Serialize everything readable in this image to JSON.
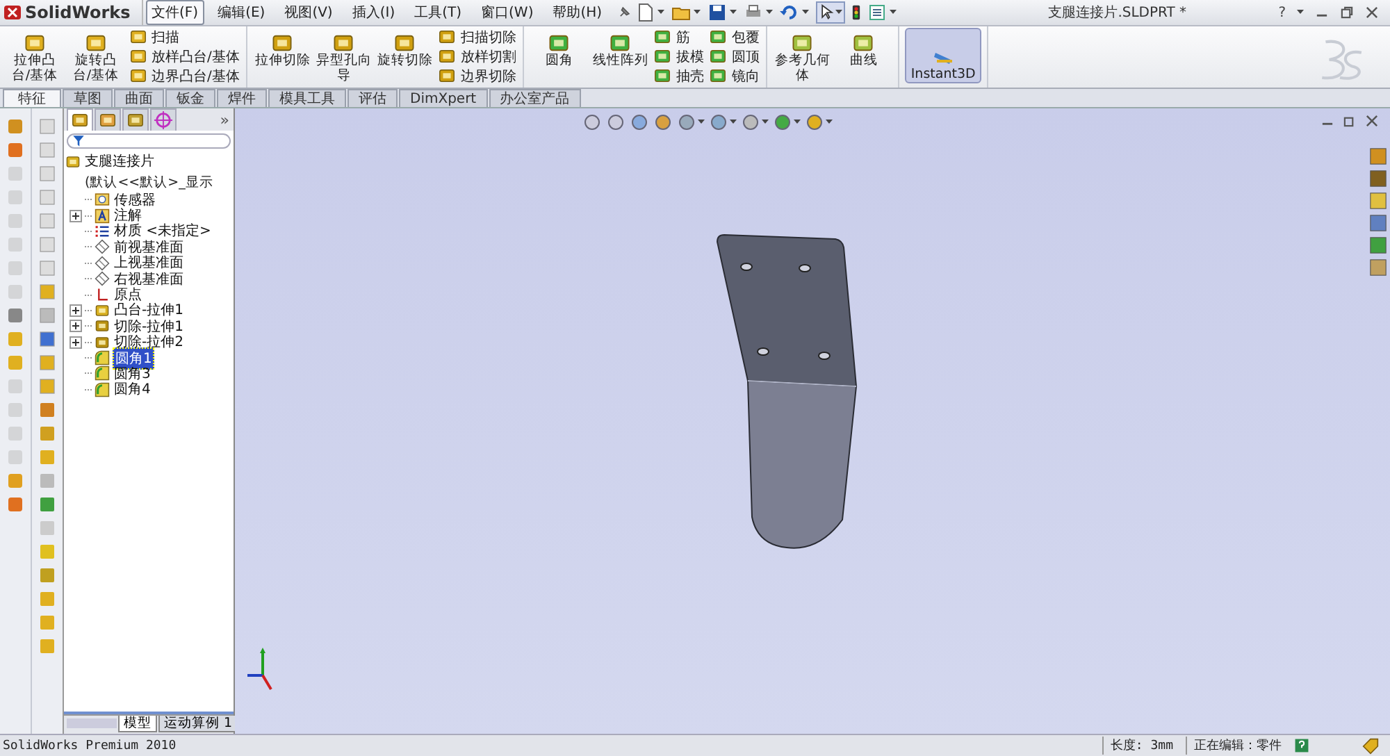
{
  "app": {
    "logo": "SolidWorks"
  },
  "menu": [
    {
      "label": "文件(F)",
      "selected": true
    },
    {
      "label": "编辑(E)",
      "selected": false
    },
    {
      "label": "视图(V)",
      "selected": false
    },
    {
      "label": "插入(I)",
      "selected": false
    },
    {
      "label": "工具(T)",
      "selected": false
    },
    {
      "label": "窗口(W)",
      "selected": false
    },
    {
      "label": "帮助(H)",
      "selected": false
    }
  ],
  "window": {
    "title": "支腿连接片.SLDPRT *",
    "help": "?"
  },
  "ribbon": {
    "groups": [
      {
        "items": [
          {
            "kind": "large",
            "label": "拉伸凸台/基体"
          },
          {
            "kind": "large",
            "label": "旋转凸台/基体"
          },
          {
            "kind": "small",
            "label": "扫描"
          },
          {
            "kind": "small",
            "label": "放样凸台/基体"
          },
          {
            "kind": "small",
            "label": "边界凸台/基体"
          }
        ]
      },
      {
        "items": [
          {
            "kind": "large",
            "label": "拉伸切除"
          },
          {
            "kind": "large",
            "label": "异型孔向导"
          },
          {
            "kind": "large",
            "label": "旋转切除"
          },
          {
            "kind": "small",
            "label": "扫描切除"
          },
          {
            "kind": "small",
            "label": "放样切割"
          },
          {
            "kind": "small",
            "label": "边界切除"
          }
        ]
      },
      {
        "items": [
          {
            "kind": "large",
            "label": "圆角"
          },
          {
            "kind": "large",
            "label": "线性阵列"
          },
          {
            "kind": "small",
            "label": "筋"
          },
          {
            "kind": "small",
            "label": "拔模"
          },
          {
            "kind": "small",
            "label": "抽壳"
          },
          {
            "kind": "small",
            "label": "包覆"
          },
          {
            "kind": "small",
            "label": "圆顶"
          },
          {
            "kind": "small",
            "label": "镜向"
          }
        ]
      },
      {
        "items": [
          {
            "kind": "large",
            "label": "参考几何体"
          },
          {
            "kind": "large",
            "label": "曲线"
          }
        ]
      },
      {
        "items": [
          {
            "kind": "toggle",
            "label": "Instant3D",
            "selected": true
          }
        ]
      }
    ]
  },
  "feature_tabs": [
    {
      "label": "特征",
      "selected": true
    },
    {
      "label": "草图",
      "selected": false
    },
    {
      "label": "曲面",
      "selected": false
    },
    {
      "label": "钣金",
      "selected": false
    },
    {
      "label": "焊件",
      "selected": false
    },
    {
      "label": "模具工具",
      "selected": false
    },
    {
      "label": "评估",
      "selected": false
    },
    {
      "label": "DimXpert",
      "selected": false
    },
    {
      "label": "办公室产品",
      "selected": false
    }
  ],
  "panel": {
    "collapse": "»",
    "tree": {
      "label": "支腿连接片",
      "config": "(默认<<默认>_显示",
      "children": [
        {
          "kind": "sensor",
          "label": "传感器",
          "selected": false
        },
        {
          "kind": "annotation",
          "label": "注解",
          "selected": false,
          "expanded": false
        },
        {
          "kind": "material",
          "label": "材质 <未指定>",
          "selected": false
        },
        {
          "kind": "plane",
          "label": "前视基准面",
          "selected": false
        },
        {
          "kind": "plane",
          "label": "上视基准面",
          "selected": false
        },
        {
          "kind": "plane",
          "label": "右视基准面",
          "selected": false
        },
        {
          "kind": "origin",
          "label": "原点",
          "selected": false
        },
        {
          "kind": "boss",
          "label": "凸台-拉伸1",
          "selected": false,
          "expanded": false
        },
        {
          "kind": "cut",
          "label": "切除-拉伸1",
          "selected": false,
          "expanded": false
        },
        {
          "kind": "cut",
          "label": "切除-拉伸2",
          "selected": false,
          "expanded": false
        },
        {
          "kind": "fillet",
          "label": "圆角1",
          "selected": true
        },
        {
          "kind": "fillet",
          "label": "圆角3",
          "selected": false
        },
        {
          "kind": "fillet",
          "label": "圆角4",
          "selected": false
        }
      ]
    },
    "bottom_tabs": [
      {
        "label": "模型",
        "selected": true
      },
      {
        "label": "运动算例 1",
        "selected": false
      }
    ]
  },
  "status_bar": {
    "product": "SolidWorks Premium 2010",
    "length": "长度: 3mm",
    "mode": "正在编辑：零件"
  }
}
